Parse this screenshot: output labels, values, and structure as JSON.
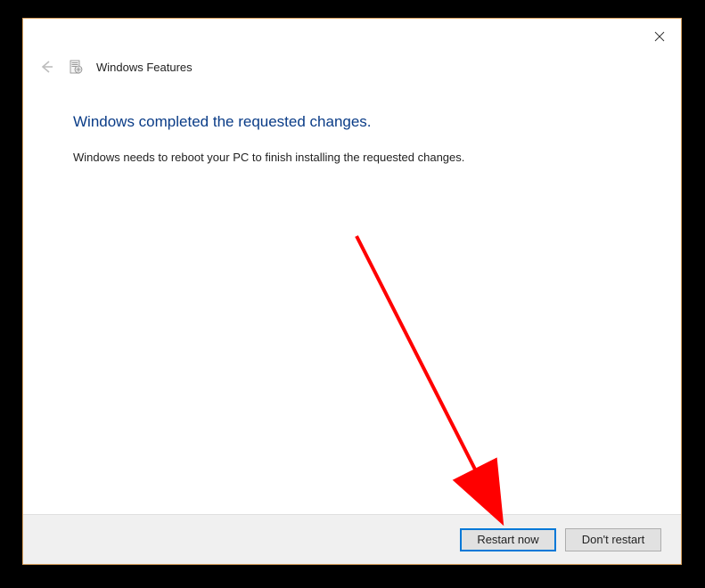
{
  "header": {
    "title": "Windows Features"
  },
  "content": {
    "heading": "Windows completed the requested changes.",
    "body": "Windows needs to reboot your PC to finish installing the requested changes."
  },
  "buttons": {
    "primary_label": "Restart now",
    "secondary_label": "Don't restart"
  }
}
